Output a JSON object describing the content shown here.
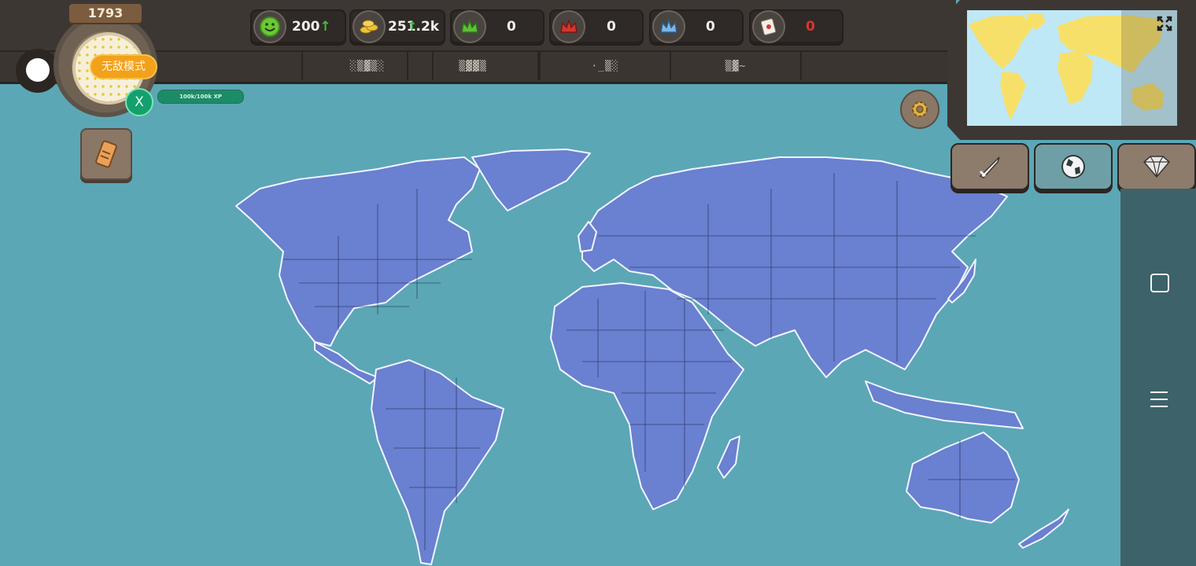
{
  "header": {
    "year": "1793",
    "mode_label": "无敌模式",
    "player_button": "X",
    "xp_label": "100k/100k XP"
  },
  "resources": [
    {
      "name": "population",
      "icon": "smiley-icon",
      "value": "200",
      "trend": "up"
    },
    {
      "name": "gold",
      "icon": "coins-icon",
      "value": "251.2k",
      "trend": "up"
    },
    {
      "name": "green-crown",
      "icon": "green-crown-icon",
      "value": "0"
    },
    {
      "name": "red-crown",
      "icon": "red-crown-icon",
      "value": "0"
    },
    {
      "name": "blue-crown",
      "icon": "blue-crown-icon",
      "value": "0"
    },
    {
      "name": "cards",
      "icon": "card-icon",
      "value": "0",
      "color": "#d8372d"
    }
  ],
  "subtabs": [
    "░▒▓▒░",
    "▒▓▓▒",
    "·_▒░",
    "▒▓~"
  ],
  "icons": {
    "scroll": "scroll-icon",
    "settings": "gear-icon",
    "expand": "expand-icon",
    "sword": "sword-icon",
    "globe": "globe-icon",
    "diamond": "diamond-icon"
  },
  "colors": {
    "ocean": "#5ba7b6",
    "land": "#6a80d0",
    "minimap_land": "#f7e06a",
    "minimap_ocean": "#bfe8f6"
  }
}
